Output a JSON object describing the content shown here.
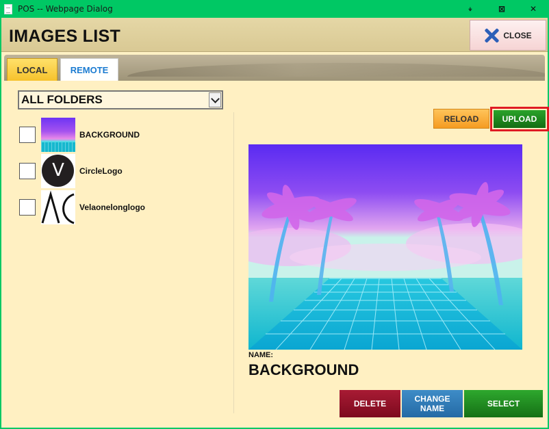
{
  "window": {
    "title": "POS -- Webpage Dialog",
    "buttons": [
      "⍖",
      "⊠",
      "✕"
    ]
  },
  "header": {
    "title": "IMAGES LIST",
    "close_label": "CLOSE"
  },
  "tabs": [
    {
      "label": "LOCAL",
      "active": true
    },
    {
      "label": "REMOTE",
      "active": false
    }
  ],
  "folder_select": {
    "value": "ALL FOLDERS"
  },
  "toolbar": {
    "reload_label": "RELOAD",
    "upload_label": "UPLOAD"
  },
  "images": [
    {
      "name": "BACKGROUND",
      "checked": false,
      "thumb": "gradient-landscape"
    },
    {
      "name": "CircleLogo",
      "checked": false,
      "thumb": "circle-v-logo"
    },
    {
      "name": "Velaonelonglogo",
      "checked": false,
      "thumb": "line-logo"
    }
  ],
  "preview": {
    "name_label": "NAME:",
    "name_value": "BACKGROUND"
  },
  "actions": {
    "delete_label": "DELETE",
    "change_name_label": "CHANGE NAME",
    "select_label": "SELECT"
  },
  "colors": {
    "titlebar": "#00c864",
    "panel": "#fff0c2",
    "reload": "#f59c22",
    "upload": "#146d14",
    "delete": "#7d0a1e",
    "change_name": "#246aa5",
    "select": "#157015",
    "highlight": "#e01b23"
  }
}
